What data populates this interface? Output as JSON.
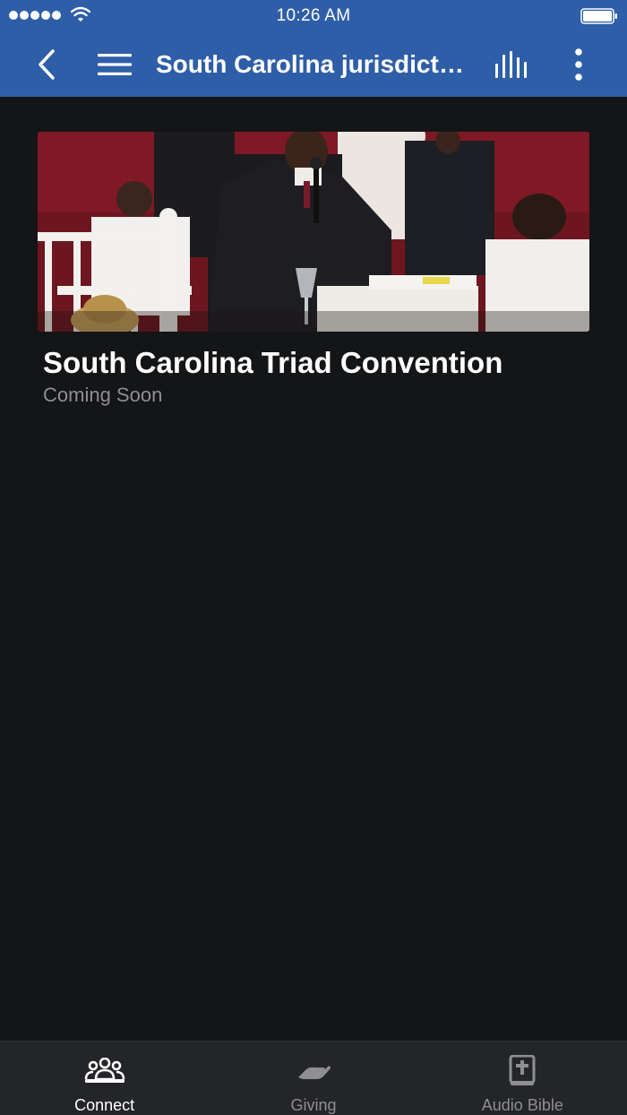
{
  "status_bar": {
    "time": "10:26 AM",
    "signal_bars": 5,
    "icons": [
      "signal-dots-icon",
      "wifi-icon",
      "battery-icon"
    ]
  },
  "nav": {
    "title": "South Carolina jurisdicti...",
    "icons": [
      "back-chevron-icon",
      "hamburger-menu-icon",
      "stats-bars-icon",
      "more-vertical-icon"
    ]
  },
  "card": {
    "title": "South Carolina Triad Convention",
    "subtitle": "Coming Soon",
    "image_description_icon": "convention-photo"
  },
  "tabs": [
    {
      "label": "Connect",
      "icon": "people-group-icon",
      "active": true
    },
    {
      "label": "Giving",
      "icon": "giving-hand-icon",
      "active": false
    },
    {
      "label": "Audio Bible",
      "icon": "bible-book-icon",
      "active": false
    }
  ],
  "colors": {
    "header": "#2f5ea8",
    "background": "#141517",
    "tab_bar": "#242528",
    "active_tab": "#ffffff",
    "inactive_tab": "#8e8e93",
    "subtitle": "#8e8e93"
  }
}
